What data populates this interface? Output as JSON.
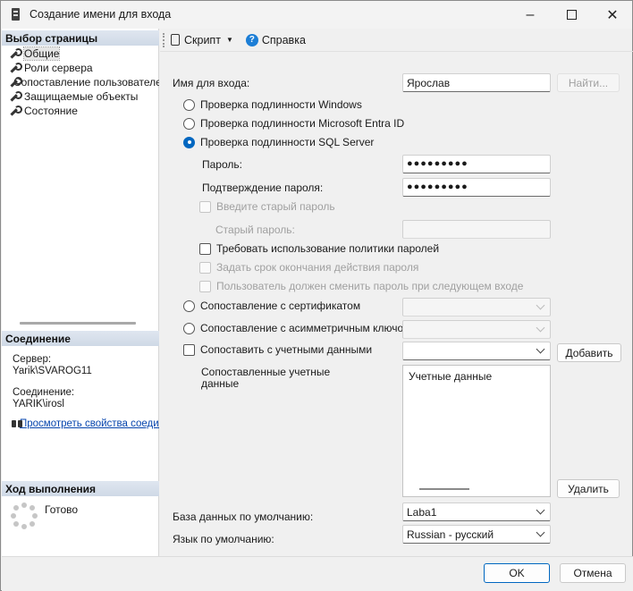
{
  "window": {
    "title": "Создание имени для входа"
  },
  "sidebar": {
    "select_page_header": "Выбор страницы",
    "items": [
      {
        "label": "Общие",
        "selected": true
      },
      {
        "label": "Роли сервера",
        "selected": false
      },
      {
        "label": "Сопоставление пользователей",
        "selected": false
      },
      {
        "label": "Защищаемые объекты",
        "selected": false
      },
      {
        "label": "Состояние",
        "selected": false
      }
    ],
    "connection_header": "Соединение",
    "server_label": "Сервер:",
    "server_value": "Yarik\\SVAROG11",
    "connection_label": "Соединение:",
    "connection_value": "YARIK\\irosl",
    "view_properties_link": "Просмотреть свойства соединения",
    "progress_header": "Ход выполнения",
    "progress_status": "Готово"
  },
  "toolbar": {
    "script_label": "Скрипт",
    "help_label": "Справка"
  },
  "form": {
    "login_label": "Имя для входа:",
    "login_value": "Ярослав",
    "find_button": "Найти...",
    "auth_windows": "Проверка подлинности Windows",
    "auth_entra": "Проверка подлинности Microsoft Entra ID",
    "auth_sql": "Проверка подлинности SQL Server",
    "auth_selected": "sql",
    "password_label": "Пароль:",
    "password_value": "●●●●●●●●●",
    "confirm_label": "Подтверждение пароля:",
    "confirm_value": "●●●●●●●●●",
    "old_password_check": "Введите старый пароль",
    "old_password_label": "Старый пароль:",
    "enforce_policy": "Требовать использование политики паролей",
    "enforce_expiration": "Задать срок окончания действия пароля",
    "must_change": "Пользователь должен сменить пароль при следующем входе",
    "map_certificate": "Сопоставление с сертификатом",
    "map_asymmetric_key": "Сопоставление с асимметричным ключом",
    "map_credentials": "Сопоставить с учетными данными",
    "add_button": "Добавить",
    "mapped_credentials_label": "Сопоставленные учетные данные",
    "list_header": "Учетные данные",
    "remove_button": "Удалить",
    "default_db_label": "База данных по умолчанию:",
    "default_db_value": "Laba1",
    "default_lang_label": "Язык по умолчанию:",
    "default_lang_value": "Russian - русский"
  },
  "footer": {
    "ok_button": "OK",
    "cancel_button": "Отмена"
  },
  "colors": {
    "accent": "#0067c0",
    "link": "#0645ad"
  }
}
